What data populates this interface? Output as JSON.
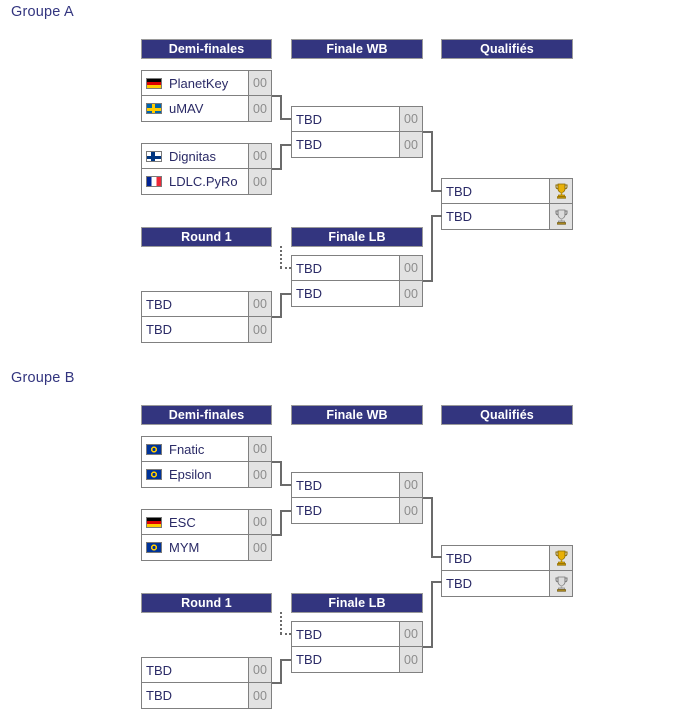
{
  "page": {
    "groups": [
      {
        "title": "Groupe A",
        "stages": [
          {
            "label": "Demi-finales"
          },
          {
            "label": "Finale WB"
          },
          {
            "label": "Qualifiés"
          },
          {
            "label": "Round 1"
          },
          {
            "label": "Finale LB"
          }
        ],
        "semifinals": [
          {
            "slots": [
              {
                "flag": "flag-germany",
                "team": "PlanetKey",
                "score": "00"
              },
              {
                "flag": "flag-sweden",
                "team": "uMAV",
                "score": "00"
              }
            ]
          },
          {
            "slots": [
              {
                "flag": "flag-finland",
                "team": "Dignitas",
                "score": "00"
              },
              {
                "flag": "flag-france",
                "team": "LDLC.PyRo",
                "score": "00"
              }
            ]
          }
        ],
        "winners_final": {
          "slots": [
            {
              "team": "TBD",
              "score": "00"
            },
            {
              "team": "TBD",
              "score": "00"
            }
          ]
        },
        "qualified": {
          "slots": [
            {
              "team": "TBD",
              "icon": "trophy-gold-icon"
            },
            {
              "team": "TBD",
              "icon": "trophy-silver-icon"
            }
          ]
        },
        "round1": {
          "slots": [
            {
              "team": "TBD",
              "score": "00"
            },
            {
              "team": "TBD",
              "score": "00"
            }
          ]
        },
        "losers_final": {
          "slots": [
            {
              "team": "TBD",
              "score": "00"
            },
            {
              "team": "TBD",
              "score": "00"
            }
          ]
        }
      },
      {
        "title": "Groupe B",
        "stages": [
          {
            "label": "Demi-finales"
          },
          {
            "label": "Finale WB"
          },
          {
            "label": "Qualifiés"
          },
          {
            "label": "Round 1"
          },
          {
            "label": "Finale LB"
          }
        ],
        "semifinals": [
          {
            "slots": [
              {
                "flag": "flag-eu",
                "team": "Fnatic",
                "score": "00"
              },
              {
                "flag": "flag-eu",
                "team": "Epsilon",
                "score": "00"
              }
            ]
          },
          {
            "slots": [
              {
                "flag": "flag-germany",
                "team": "ESC",
                "score": "00"
              },
              {
                "flag": "flag-eu",
                "team": "MYM",
                "score": "00"
              }
            ]
          }
        ],
        "winners_final": {
          "slots": [
            {
              "team": "TBD",
              "score": "00"
            },
            {
              "team": "TBD",
              "score": "00"
            }
          ]
        },
        "qualified": {
          "slots": [
            {
              "team": "TBD",
              "icon": "trophy-gold-icon"
            },
            {
              "team": "TBD",
              "icon": "trophy-silver-icon"
            }
          ]
        },
        "round1": {
          "slots": [
            {
              "team": "TBD",
              "score": "00"
            },
            {
              "team": "TBD",
              "score": "00"
            }
          ]
        },
        "losers_final": {
          "slots": [
            {
              "team": "TBD",
              "score": "00"
            },
            {
              "team": "TBD",
              "score": "00"
            }
          ]
        }
      }
    ],
    "colors": {
      "header_bg": "#33357f",
      "header_text": "#ffffff",
      "text": "#2a2a66",
      "score_bg": "#e2e2e2",
      "score_text": "#8c8c8c",
      "border": "#808080",
      "connector": "#6b6b6b"
    }
  }
}
